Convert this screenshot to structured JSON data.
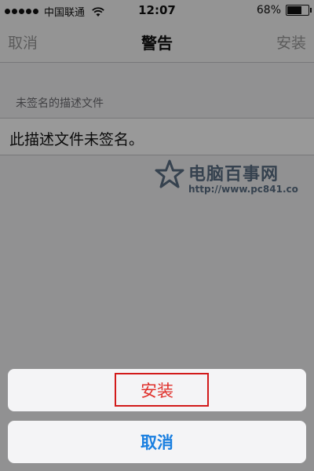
{
  "status_bar": {
    "carrier": "中国联通",
    "time": "12:07",
    "battery_percent": "68%",
    "battery_level": 0.68
  },
  "nav": {
    "cancel_label": "取消",
    "title": "警告",
    "install_label": "安装"
  },
  "section": {
    "header": "未签名的描述文件",
    "row_text": "此描述文件未签名。"
  },
  "watermark": {
    "title": "电脑百事网",
    "url": "http://www.pc841.co"
  },
  "action_sheet": {
    "install_label": "安装",
    "cancel_label": "取消"
  },
  "colors": {
    "install_red": "#e0302b",
    "cancel_blue": "#1a7fe0",
    "highlight_red": "#d21a1a"
  }
}
